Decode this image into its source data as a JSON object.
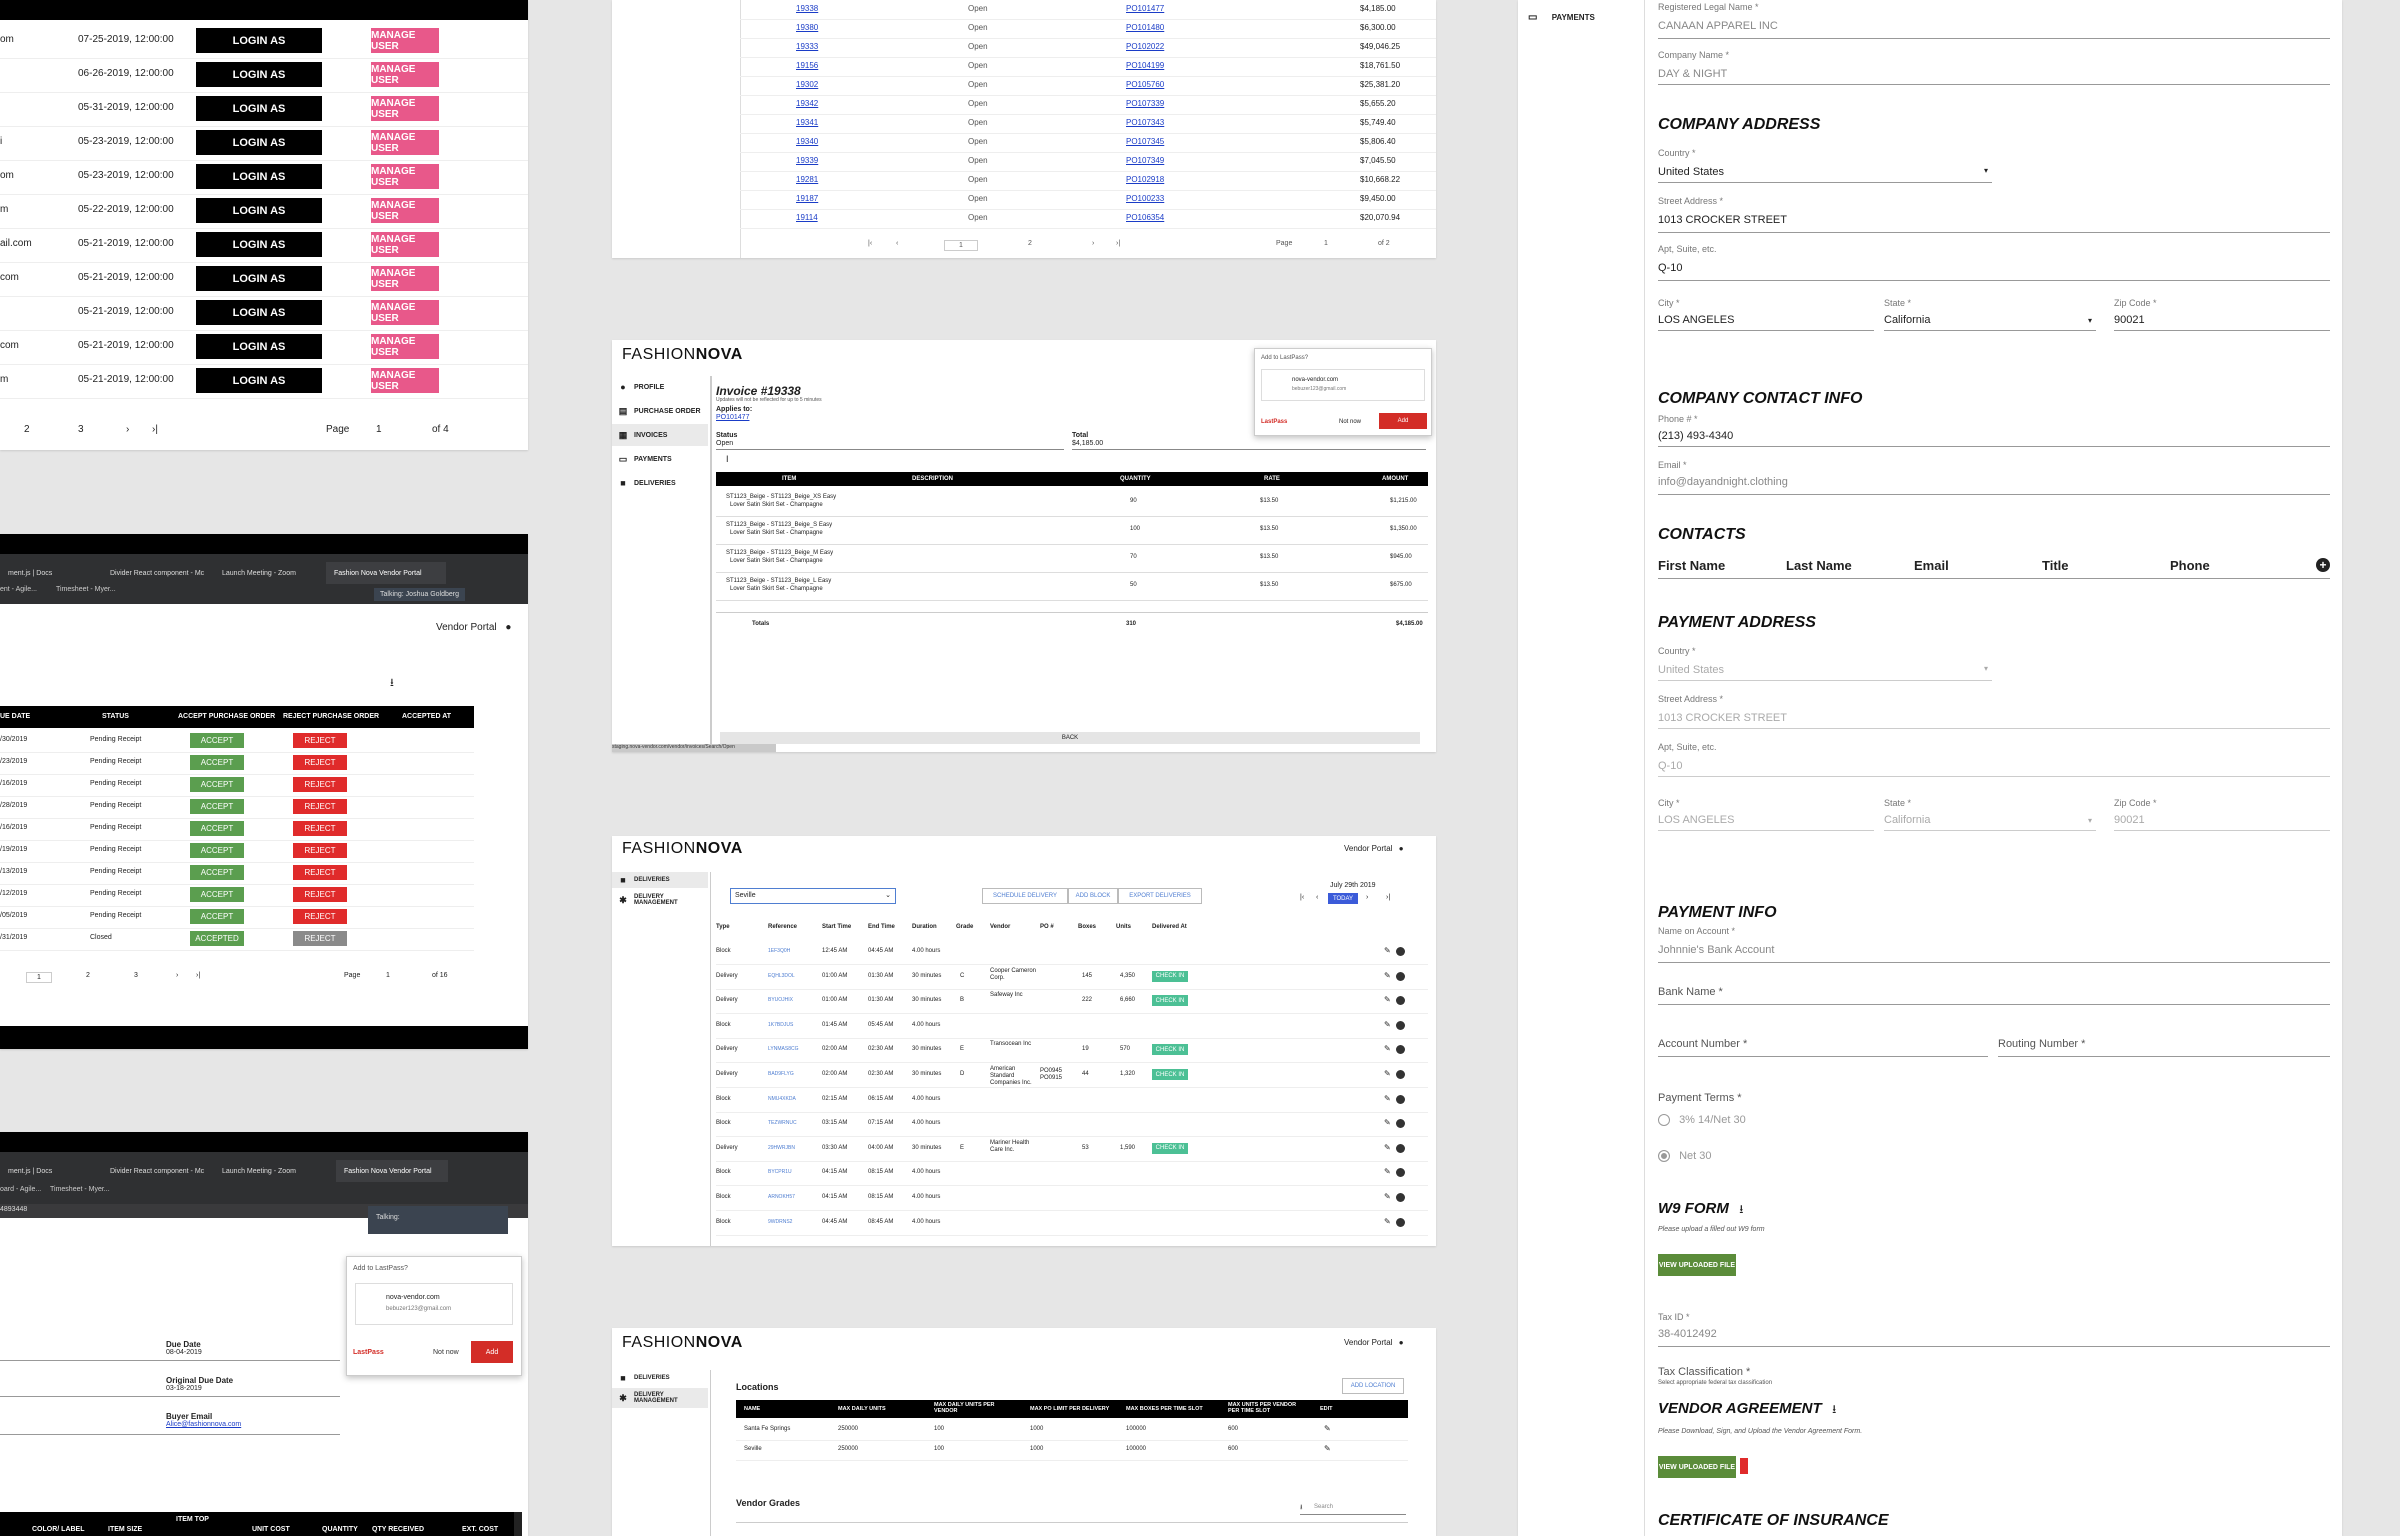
{
  "users_panel": {
    "rows": [
      {
        "email_tail": "om",
        "date": "07-25-2019, 12:00:00"
      },
      {
        "email_tail": "",
        "date": "06-26-2019, 12:00:00"
      },
      {
        "email_tail": "",
        "date": "05-31-2019, 12:00:00"
      },
      {
        "email_tail": "i",
        "date": "05-23-2019, 12:00:00"
      },
      {
        "email_tail": "om",
        "date": "05-23-2019, 12:00:00"
      },
      {
        "email_tail": "m",
        "date": "05-22-2019, 12:00:00"
      },
      {
        "email_tail": "ail.com",
        "date": "05-21-2019, 12:00:00"
      },
      {
        "email_tail": "com",
        "date": "05-21-2019, 12:00:00"
      },
      {
        "email_tail": "",
        "date": "05-21-2019, 12:00:00"
      },
      {
        "email_tail": "com",
        "date": "05-21-2019, 12:00:00"
      },
      {
        "email_tail": "m",
        "date": "05-21-2019, 12:00:00"
      }
    ],
    "login_label": "LOGIN AS",
    "manage_label": "MANAGE USER",
    "pagination": {
      "p2": "2",
      "p3": "3",
      "next": "›",
      "last": "›|",
      "page_label": "Page",
      "page_value": "1",
      "of": "of 4"
    }
  },
  "po_panel": {
    "tabs": [
      "ment.js | Docs",
      "Divider React component - Mc",
      "Launch Meeting - Zoom",
      "Fashion Nova Vendor Portal"
    ],
    "bookmarks": [
      "ent - Agile...",
      "Timesheet - Myer..."
    ],
    "talking": "Talking: Joshua Goldberg",
    "vendor_portal": "Vendor Portal",
    "headers": [
      "UE DATE",
      "STATUS",
      "ACCEPT PURCHASE ORDER",
      "REJECT PURCHASE ORDER",
      "ACCEPTED AT"
    ],
    "rows": [
      {
        "date": "/30/2019",
        "status": "Pending Receipt",
        "accept": "ACCEPT",
        "reject": "REJECT"
      },
      {
        "date": "/23/2019",
        "status": "Pending Receipt",
        "accept": "ACCEPT",
        "reject": "REJECT"
      },
      {
        "date": "/16/2019",
        "status": "Pending Receipt",
        "accept": "ACCEPT",
        "reject": "REJECT"
      },
      {
        "date": "/28/2019",
        "status": "Pending Receipt",
        "accept": "ACCEPT",
        "reject": "REJECT"
      },
      {
        "date": "/16/2019",
        "status": "Pending Receipt",
        "accept": "ACCEPT",
        "reject": "REJECT"
      },
      {
        "date": "/19/2019",
        "status": "Pending Receipt",
        "accept": "ACCEPT",
        "reject": "REJECT"
      },
      {
        "date": "/13/2019",
        "status": "Pending Receipt",
        "accept": "ACCEPT",
        "reject": "REJECT"
      },
      {
        "date": "/12/2019",
        "status": "Pending Receipt",
        "accept": "ACCEPT",
        "reject": "REJECT"
      },
      {
        "date": "/05/2019",
        "status": "Pending Receipt",
        "accept": "ACCEPT",
        "reject": "REJECT"
      },
      {
        "date": "/31/2019",
        "status": "Closed",
        "accept": "ACCEPTED",
        "reject": "REJECT"
      }
    ],
    "pagination": {
      "p1": "1",
      "p2": "2",
      "p3": "3",
      "next": "›",
      "last": "›|",
      "page_label": "Page",
      "page_value": "1",
      "of": "of 16"
    }
  },
  "order_detail_panel": {
    "tabs": [
      "ment.js | Docs",
      "Divider React component - Mc",
      "Launch Meeting - Zoom",
      "Fashion Nova Vendor Portal"
    ],
    "bookmarks": [
      "oard - Agile...",
      "Timesheet - Myer..."
    ],
    "url_fragment": "4893448",
    "talking": "Talking:",
    "lastpass": {
      "title": "Add to LastPass?",
      "site": "nova-vendor.com",
      "user": "bebuzer123@gmail.com",
      "brand": "LastPass",
      "not_now": "Not now",
      "add": "Add"
    },
    "due_date_label": "Due Date",
    "due_date": "08-04-2019",
    "orig_due_label": "Original Due Date",
    "orig_due": "03-18-2019",
    "buyer_email_label": "Buyer Email",
    "buyer_email": "Alice@fashionnova.com",
    "headers": [
      "COLOR/ LABEL",
      "ITEM SIZE",
      "ITEM TOP",
      "UNIT COST",
      "QUANTITY",
      "QTY RECEIVED",
      "EXT. COST"
    ]
  },
  "invoices_list_panel": {
    "rows": [
      {
        "id": "19338",
        "status": "Open",
        "po": "PO101477",
        "amount": "$4,185.00"
      },
      {
        "id": "19380",
        "status": "Open",
        "po": "PO101480",
        "amount": "$6,300.00"
      },
      {
        "id": "19333",
        "status": "Open",
        "po": "PO102022",
        "amount": "$49,046.25"
      },
      {
        "id": "19156",
        "status": "Open",
        "po": "PO104199",
        "amount": "$18,761.50"
      },
      {
        "id": "19302",
        "status": "Open",
        "po": "PO105760",
        "amount": "$25,381.20"
      },
      {
        "id": "19342",
        "status": "Open",
        "po": "PO107339",
        "amount": "$5,655.20"
      },
      {
        "id": "19341",
        "status": "Open",
        "po": "PO107343",
        "amount": "$5,749.40"
      },
      {
        "id": "19340",
        "status": "Open",
        "po": "PO107345",
        "amount": "$5,806.40"
      },
      {
        "id": "19339",
        "status": "Open",
        "po": "PO107349",
        "amount": "$7,045.50"
      },
      {
        "id": "19281",
        "status": "Open",
        "po": "PO102918",
        "amount": "$10,668.22"
      },
      {
        "id": "19187",
        "status": "Open",
        "po": "PO100233",
        "amount": "$9,450.00"
      },
      {
        "id": "19114",
        "status": "Open",
        "po": "PO106354",
        "amount": "$20,070.94"
      }
    ],
    "pagination": {
      "first": "|‹",
      "prev": "‹",
      "p1": "1",
      "p2": "2",
      "next": "›",
      "last": "›|",
      "page_label": "Page",
      "page_value": "1",
      "of": "of 2"
    }
  },
  "invoice_panel": {
    "logo_light": "FASHION",
    "logo_bold": "NOVA",
    "sidebar": [
      "PROFILE",
      "PURCHASE ORDER",
      "INVOICES",
      "PAYMENTS",
      "DELIVERIES"
    ],
    "title": "Invoice #19338",
    "subtitle": "Updates will not be reflected for up to 5 minutes",
    "applies_label": "Applies to:",
    "applies_po": "PO101477",
    "status_label": "Status",
    "status": "Open",
    "total_label": "Total",
    "total": "$4,185.00",
    "lastpass": {
      "title": "Add to LastPass?",
      "site": "nova-vendor.com",
      "user": "bebuzer123@gmail.com",
      "brand": "LastPass",
      "not_now": "Not now",
      "add": "Add"
    },
    "headers": [
      "ITEM",
      "DESCRIPTION",
      "QUANTITY",
      "RATE",
      "AMOUNT"
    ],
    "rows": [
      {
        "item1": "ST1123_Beige - ST1123_Beige_XS Easy",
        "item2": "Lover Satin Skirt Set - Champagne",
        "qty": "90",
        "rate": "$13.50",
        "amount": "$1,215.00"
      },
      {
        "item1": "ST1123_Beige - ST1123_Beige_S Easy",
        "item2": "Lover Satin Skirt Set - Champagne",
        "qty": "100",
        "rate": "$13.50",
        "amount": "$1,350.00"
      },
      {
        "item1": "ST1123_Beige - ST1123_Beige_M Easy",
        "item2": "Lover Satin Skirt Set - Champagne",
        "qty": "70",
        "rate": "$13.50",
        "amount": "$945.00"
      },
      {
        "item1": "ST1123_Beige - ST1123_Beige_L Easy",
        "item2": "Lover Satin Skirt Set - Champagne",
        "qty": "50",
        "rate": "$13.50",
        "amount": "$675.00"
      }
    ],
    "totals_label": "Totals",
    "totals_qty": "310",
    "totals_amount": "$4,185.00",
    "back": "BACK",
    "status_url": "staging.nova-vendor.com/vendor/invoices/Search/Open"
  },
  "deliveries_panel": {
    "logo_light": "FASHION",
    "logo_bold": "NOVA",
    "vendor_portal": "Vendor Portal",
    "sidebar": [
      "DELIVERIES",
      "DELIVERY MANAGEMENT"
    ],
    "location": "Seville",
    "actions": [
      "SCHEDULE DELIVERY",
      "ADD BLOCK",
      "EXPORT DELIVERIES"
    ],
    "date": "July 29th 2019",
    "today": "TODAY",
    "headers": [
      "Type",
      "Reference",
      "Start Time",
      "End Time",
      "Duration",
      "Grade",
      "Vendor",
      "PO #",
      "Boxes",
      "Units",
      "Delivered At"
    ],
    "rows": [
      {
        "type": "Block",
        "ref": "1EF3Q0H",
        "start": "12:45 AM",
        "end": "04:45 AM",
        "dur": "4.00 hours",
        "grade": "",
        "vendor": "",
        "po": "",
        "boxes": "",
        "units": "",
        "checkin": false
      },
      {
        "type": "Delivery",
        "ref": "EQHL3DOL",
        "start": "01:00 AM",
        "end": "01:30 AM",
        "dur": "30 minutes",
        "grade": "C",
        "vendor": "Cooper Cameron Corp.",
        "po": "",
        "boxes": "145",
        "units": "4,350",
        "checkin": true
      },
      {
        "type": "Delivery",
        "ref": "BYUOJHIX",
        "start": "01:00 AM",
        "end": "01:30 AM",
        "dur": "30 minutes",
        "grade": "B",
        "vendor": "Safeway Inc",
        "po": "",
        "boxes": "222",
        "units": "6,660",
        "checkin": true
      },
      {
        "type": "Block",
        "ref": "1K7BDJUS",
        "start": "01:45 AM",
        "end": "05:45 AM",
        "dur": "4.00 hours",
        "grade": "",
        "vendor": "",
        "po": "",
        "boxes": "",
        "units": "",
        "checkin": false
      },
      {
        "type": "Delivery",
        "ref": "LYNMAS8CG",
        "start": "02:00 AM",
        "end": "02:30 AM",
        "dur": "30 minutes",
        "grade": "E",
        "vendor": "Transocean Inc",
        "po": "",
        "boxes": "19",
        "units": "570",
        "checkin": true
      },
      {
        "type": "Delivery",
        "ref": "BAD9FLYG",
        "start": "02:00 AM",
        "end": "02:30 AM",
        "dur": "30 minutes",
        "grade": "D",
        "vendor": "American Standard Companies Inc.",
        "po": "PO0945 PO0915",
        "boxes": "44",
        "units": "1,320",
        "checkin": true
      },
      {
        "type": "Block",
        "ref": "NMU4XKDA",
        "start": "02:15 AM",
        "end": "06:15 AM",
        "dur": "4.00 hours",
        "grade": "",
        "vendor": "",
        "po": "",
        "boxes": "",
        "units": "",
        "checkin": false
      },
      {
        "type": "Block",
        "ref": "TEZWRNUC",
        "start": "03:15 AM",
        "end": "07:15 AM",
        "dur": "4.00 hours",
        "grade": "",
        "vendor": "",
        "po": "",
        "boxes": "",
        "units": "",
        "checkin": false
      },
      {
        "type": "Delivery",
        "ref": "29HWRJBN",
        "start": "03:30 AM",
        "end": "04:00 AM",
        "dur": "30 minutes",
        "grade": "E",
        "vendor": "Mariner Health Care Inc.",
        "po": "",
        "boxes": "53",
        "units": "1,590",
        "checkin": true
      },
      {
        "type": "Block",
        "ref": "BYCPR1U",
        "start": "04:15 AM",
        "end": "08:15 AM",
        "dur": "4.00 hours",
        "grade": "",
        "vendor": "",
        "po": "",
        "boxes": "",
        "units": "",
        "checkin": false
      },
      {
        "type": "Block",
        "ref": "ARNOKH57",
        "start": "04:15 AM",
        "end": "08:15 AM",
        "dur": "4.00 hours",
        "grade": "",
        "vendor": "",
        "po": "",
        "boxes": "",
        "units": "",
        "checkin": false
      },
      {
        "type": "Block",
        "ref": "9WDRNS2",
        "start": "04:45 AM",
        "end": "08:45 AM",
        "dur": "4.00 hours",
        "grade": "",
        "vendor": "",
        "po": "",
        "boxes": "",
        "units": "",
        "checkin": false
      }
    ],
    "checkin_label": "CHECK IN"
  },
  "locations_panel": {
    "logo_light": "FASHION",
    "logo_bold": "NOVA",
    "vendor_portal": "Vendor Portal",
    "sidebar": [
      "DELIVERIES",
      "DELIVERY MANAGEMENT"
    ],
    "title": "Locations",
    "add": "ADD LOCATION",
    "headers": [
      "NAME",
      "MAX DAILY UNITS",
      "MAX DAILY UNITS PER VENDOR",
      "MAX PO LIMIT PER DELIVERY",
      "MAX BOXES PER TIME SLOT",
      "MAX UNITS PER VENDOR PER TIME SLOT",
      "EDIT"
    ],
    "rows": [
      {
        "name": "Santa Fe Springs",
        "daily": "250000",
        "per_vendor": "100",
        "po_limit": "1000",
        "boxes": "100000",
        "units": "600"
      },
      {
        "name": "Seville",
        "daily": "250000",
        "per_vendor": "100",
        "po_limit": "1000",
        "boxes": "100000",
        "units": "600"
      }
    ],
    "grades_title": "Vendor Grades",
    "search_placeholder": "Search"
  },
  "profile_panel": {
    "sidebar_payments": "PAYMENTS",
    "registered_label": "Registered Legal Name *",
    "registered": "CANAAN APPAREL INC",
    "company_label": "Company Name *",
    "company": "DAY & NIGHT",
    "address_title": "COMPANY ADDRESS",
    "country_label": "Country *",
    "country": "United States",
    "street_label": "Street Address *",
    "street": "1013 CROCKER STREET",
    "apt_label": "Apt, Suite, etc.",
    "apt": "Q-10",
    "city_label": "City *",
    "city": "LOS ANGELES",
    "state_label": "State *",
    "state": "California",
    "zip_label": "Zip Code *",
    "zip": "90021",
    "contact_title": "COMPANY CONTACT INFO",
    "phone_label": "Phone # *",
    "phone": "(213) 493-4340",
    "email_label": "Email *",
    "email": "info@dayandnight.clothing",
    "contacts_title": "CONTACTS",
    "contacts_cols": [
      "First Name",
      "Last Name",
      "Email",
      "Title",
      "Phone"
    ],
    "pay_address_title": "PAYMENT ADDRESS",
    "pay_country": "United States",
    "pay_street": "1013 CROCKER STREET",
    "pay_apt": "Q-10",
    "pay_city": "LOS ANGELES",
    "pay_state": "California",
    "pay_zip": "90021",
    "pay_info_title": "PAYMENT INFO",
    "account_name_label": "Name on Account *",
    "account_name": "Johnnie's Bank Account",
    "bank_label": "Bank Name *",
    "account_number_label": "Account Number *",
    "routing_label": "Routing Number *",
    "terms_label": "Payment Terms *",
    "term1": "3% 14/Net 30",
    "term2": "Net 30",
    "w9_title": "W9 FORM",
    "w9_note": "Please upload a filled out W9 form",
    "view_file": "VIEW UPLOADED FILE",
    "tax_label": "Tax ID *",
    "tax": "38-4012492",
    "tax_class_label": "Tax Classification *",
    "tax_class_note": "Select appropriate federal tax classification",
    "agreement_title": "VENDOR AGREEMENT",
    "agreement_note": "Please Download, Sign, and Upload the Vendor Agreement Form.",
    "insurance_title": "CERTIFICATE OF INSURANCE"
  }
}
